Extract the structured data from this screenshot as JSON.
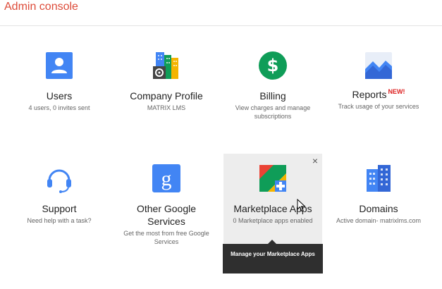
{
  "header": {
    "title": "Admin console"
  },
  "tiles": [
    {
      "title": "Users",
      "desc": "4 users, 0 invites sent",
      "icon": "users-icon"
    },
    {
      "title": "Company Profile",
      "desc": "MATRIX LMS",
      "icon": "company-profile-icon"
    },
    {
      "title": "Billing",
      "desc": "View charges and manage subscriptions",
      "icon": "billing-icon"
    },
    {
      "title": "Reports",
      "badge": "NEW!",
      "desc": "Track usage of your services",
      "icon": "reports-icon"
    },
    {
      "title": "Support",
      "desc": "Need help with a task?",
      "icon": "support-icon"
    },
    {
      "title": "Other Google Services",
      "desc": "Get the most from free Google Services",
      "icon": "google-services-icon"
    },
    {
      "title": "Marketplace Apps",
      "desc": "0 Marketplace apps enabled",
      "icon": "marketplace-icon"
    },
    {
      "title": "Domains",
      "desc": "Active domain- matrixlms.com",
      "icon": "domains-icon"
    }
  ],
  "hover_card": {
    "close": "×"
  },
  "tooltip": {
    "text": "Manage your Marketplace Apps"
  },
  "colors": {
    "brand_red": "#dd4b39",
    "blue": "#4285f4",
    "green": "#0f9d58"
  }
}
